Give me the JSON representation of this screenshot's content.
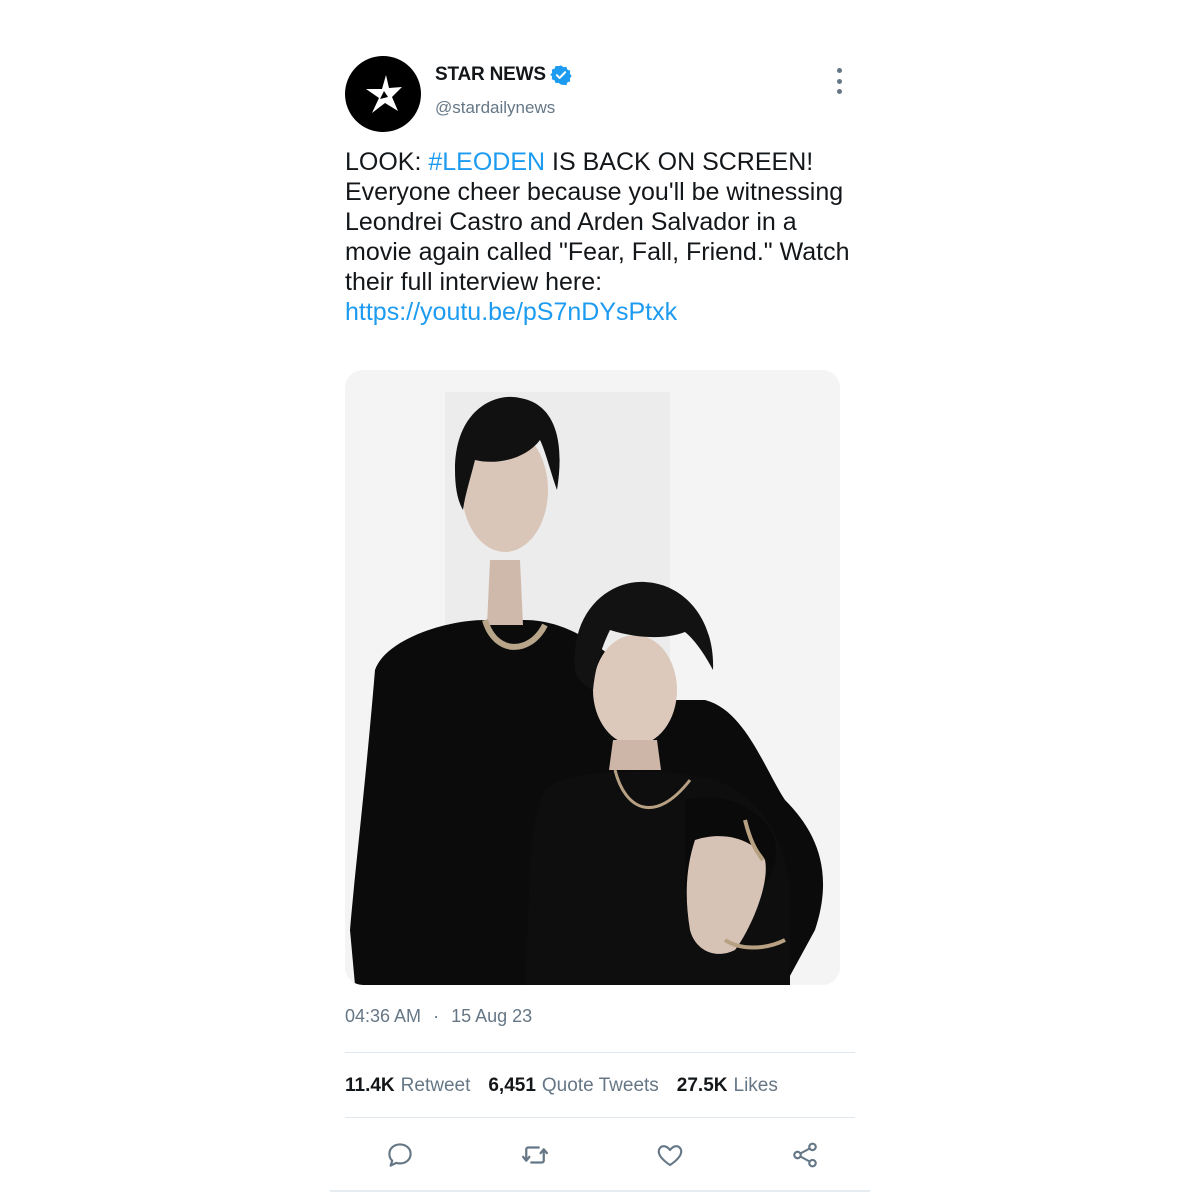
{
  "author": {
    "display_name": "STAR NEWS",
    "handle": "@stardailynews",
    "verified": true,
    "avatar_icon": "lightning-star-logo-icon"
  },
  "tweet": {
    "text_prefix": "LOOK: ",
    "hashtag": "#LEODEN",
    "text_body": " IS BACK ON SCREEN!\nEveryone cheer because you'll be witnessing Leondrei Castro and Arden Salvador in a movie again called \"Fear, Fall, Friend.\" Watch their full interview here: ",
    "link": "https://youtu.be/pS7nDYsPtxk",
    "media_icon": "photo-two-men-in-black-icon"
  },
  "meta": {
    "time": "04:36 AM",
    "separator": "·",
    "date": "15 Aug 23"
  },
  "stats": {
    "retweets_count": "11.4K",
    "retweets_label": "Retweet",
    "quotes_count": "6,451",
    "quotes_label": "Quote Tweets",
    "likes_count": "27.5K",
    "likes_label": "Likes"
  },
  "actions": {
    "reply_icon": "reply-icon",
    "retweet_icon": "retweet-icon",
    "like_icon": "heart-icon",
    "share_icon": "share-icon"
  },
  "colors": {
    "link": "#1d9bf0",
    "muted": "#657786",
    "verified": "#1d9bf0"
  }
}
